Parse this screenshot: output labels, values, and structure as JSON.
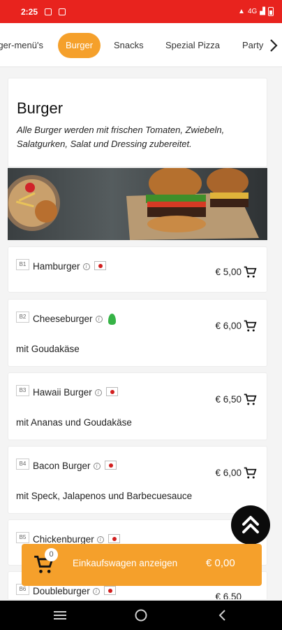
{
  "status_bar": {
    "time": "2:25",
    "signal_text": "4G"
  },
  "categories": [
    {
      "label": "rger-menü's",
      "active": false
    },
    {
      "label": "Burger",
      "active": true
    },
    {
      "label": "Snacks",
      "active": false
    },
    {
      "label": "Spezial Pizza",
      "active": false
    },
    {
      "label": "Party",
      "active": false
    }
  ],
  "section": {
    "title": "Burger",
    "description": "Alle Burger werden mit frischen Tomaten, Zwiebeln, Salatgurken, Salat und Dressing zubereitet."
  },
  "items": [
    {
      "code": "B1",
      "name": "Hamburger",
      "price": "€ 5,00",
      "description": "",
      "badge": "flag"
    },
    {
      "code": "B2",
      "name": "Cheeseburger",
      "price": "€ 6,00",
      "description": "mit Goudakäse",
      "badge": "leaf"
    },
    {
      "code": "B3",
      "name": "Hawaii Burger",
      "price": "€ 6,50",
      "description": "mit Ananas und Goudakäse",
      "badge": "flag"
    },
    {
      "code": "B4",
      "name": "Bacon Burger",
      "price": "€ 6,00",
      "description": "mit Speck, Jalapenos und Barbecuesauce",
      "badge": "flag"
    },
    {
      "code": "B5",
      "name": "Chickenburger",
      "price": "",
      "description": "",
      "badge": "flag"
    },
    {
      "code": "B6",
      "name": "Doubleburger",
      "price": "€ 6,50",
      "description": "",
      "badge": "flag"
    }
  ],
  "cart": {
    "count": "0",
    "label": "Einkaufswagen anzeigen",
    "total": "€ 0,00"
  },
  "colors": {
    "status_bar": "#e8231e",
    "accent": "#f5a02b",
    "fab": "#0b0b0b"
  }
}
